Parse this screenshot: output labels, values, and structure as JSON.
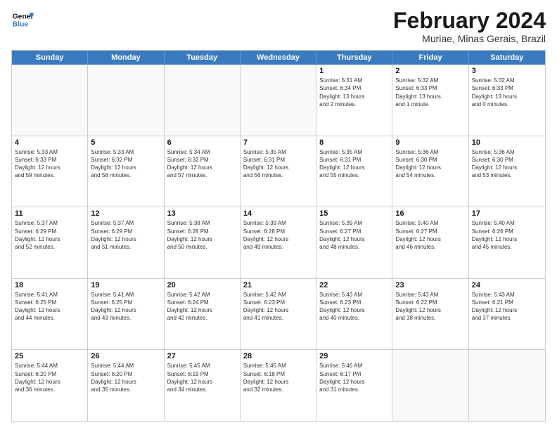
{
  "header": {
    "logo_line1": "General",
    "logo_line2": "Blue",
    "month_title": "February 2024",
    "location": "Muriae, Minas Gerais, Brazil"
  },
  "days_of_week": [
    "Sunday",
    "Monday",
    "Tuesday",
    "Wednesday",
    "Thursday",
    "Friday",
    "Saturday"
  ],
  "weeks": [
    [
      {
        "day": "",
        "info": ""
      },
      {
        "day": "",
        "info": ""
      },
      {
        "day": "",
        "info": ""
      },
      {
        "day": "",
        "info": ""
      },
      {
        "day": "1",
        "info": "Sunrise: 5:31 AM\nSunset: 6:34 PM\nDaylight: 13 hours\nand 2 minutes."
      },
      {
        "day": "2",
        "info": "Sunrise: 5:32 AM\nSunset: 6:33 PM\nDaylight: 13 hours\nand 1 minute."
      },
      {
        "day": "3",
        "info": "Sunrise: 5:32 AM\nSunset: 6:33 PM\nDaylight: 13 hours\nand 0 minutes."
      }
    ],
    [
      {
        "day": "4",
        "info": "Sunrise: 5:33 AM\nSunset: 6:33 PM\nDaylight: 12 hours\nand 59 minutes."
      },
      {
        "day": "5",
        "info": "Sunrise: 5:33 AM\nSunset: 6:32 PM\nDaylight: 12 hours\nand 58 minutes."
      },
      {
        "day": "6",
        "info": "Sunrise: 5:34 AM\nSunset: 6:32 PM\nDaylight: 12 hours\nand 57 minutes."
      },
      {
        "day": "7",
        "info": "Sunrise: 5:35 AM\nSunset: 6:31 PM\nDaylight: 12 hours\nand 56 minutes."
      },
      {
        "day": "8",
        "info": "Sunrise: 5:35 AM\nSunset: 6:31 PM\nDaylight: 12 hours\nand 55 minutes."
      },
      {
        "day": "9",
        "info": "Sunrise: 5:36 AM\nSunset: 6:30 PM\nDaylight: 12 hours\nand 54 minutes."
      },
      {
        "day": "10",
        "info": "Sunrise: 5:36 AM\nSunset: 6:30 PM\nDaylight: 12 hours\nand 53 minutes."
      }
    ],
    [
      {
        "day": "11",
        "info": "Sunrise: 5:37 AM\nSunset: 6:29 PM\nDaylight: 12 hours\nand 52 minutes."
      },
      {
        "day": "12",
        "info": "Sunrise: 5:37 AM\nSunset: 6:29 PM\nDaylight: 12 hours\nand 51 minutes."
      },
      {
        "day": "13",
        "info": "Sunrise: 5:38 AM\nSunset: 6:28 PM\nDaylight: 12 hours\nand 50 minutes."
      },
      {
        "day": "14",
        "info": "Sunrise: 5:39 AM\nSunset: 6:28 PM\nDaylight: 12 hours\nand 49 minutes."
      },
      {
        "day": "15",
        "info": "Sunrise: 5:39 AM\nSunset: 6:27 PM\nDaylight: 12 hours\nand 48 minutes."
      },
      {
        "day": "16",
        "info": "Sunrise: 5:40 AM\nSunset: 6:27 PM\nDaylight: 12 hours\nand 46 minutes."
      },
      {
        "day": "17",
        "info": "Sunrise: 5:40 AM\nSunset: 6:26 PM\nDaylight: 12 hours\nand 45 minutes."
      }
    ],
    [
      {
        "day": "18",
        "info": "Sunrise: 5:41 AM\nSunset: 6:25 PM\nDaylight: 12 hours\nand 44 minutes."
      },
      {
        "day": "19",
        "info": "Sunrise: 5:41 AM\nSunset: 6:25 PM\nDaylight: 12 hours\nand 43 minutes."
      },
      {
        "day": "20",
        "info": "Sunrise: 5:42 AM\nSunset: 6:24 PM\nDaylight: 12 hours\nand 42 minutes."
      },
      {
        "day": "21",
        "info": "Sunrise: 5:42 AM\nSunset: 6:23 PM\nDaylight: 12 hours\nand 41 minutes."
      },
      {
        "day": "22",
        "info": "Sunrise: 5:43 AM\nSunset: 6:23 PM\nDaylight: 12 hours\nand 40 minutes."
      },
      {
        "day": "23",
        "info": "Sunrise: 5:43 AM\nSunset: 6:22 PM\nDaylight: 12 hours\nand 38 minutes."
      },
      {
        "day": "24",
        "info": "Sunrise: 5:43 AM\nSunset: 6:21 PM\nDaylight: 12 hours\nand 37 minutes."
      }
    ],
    [
      {
        "day": "25",
        "info": "Sunrise: 5:44 AM\nSunset: 6:20 PM\nDaylight: 12 hours\nand 36 minutes."
      },
      {
        "day": "26",
        "info": "Sunrise: 5:44 AM\nSunset: 6:20 PM\nDaylight: 12 hours\nand 35 minutes."
      },
      {
        "day": "27",
        "info": "Sunrise: 5:45 AM\nSunset: 6:19 PM\nDaylight: 12 hours\nand 34 minutes."
      },
      {
        "day": "28",
        "info": "Sunrise: 5:45 AM\nSunset: 6:18 PM\nDaylight: 12 hours\nand 32 minutes."
      },
      {
        "day": "29",
        "info": "Sunrise: 5:46 AM\nSunset: 6:17 PM\nDaylight: 12 hours\nand 31 minutes."
      },
      {
        "day": "",
        "info": ""
      },
      {
        "day": "",
        "info": ""
      }
    ]
  ]
}
